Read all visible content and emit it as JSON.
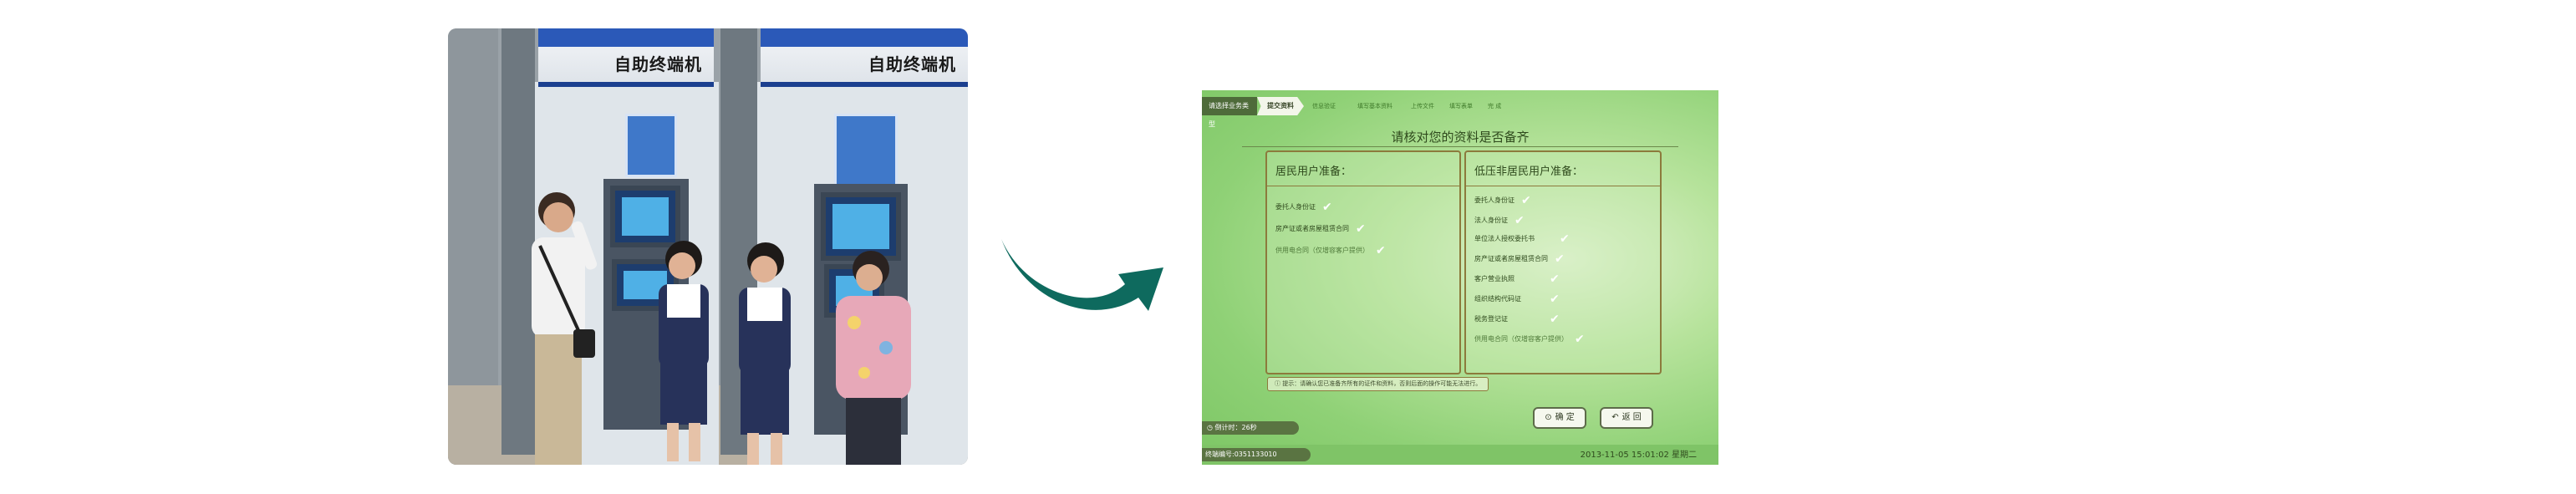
{
  "photo": {
    "kiosk_sign_left": "自助终端机",
    "kiosk_sign_right": "自助终端机"
  },
  "ui": {
    "steps": {
      "active": "请选择业务类型",
      "current": "提交资料",
      "s3": "信息验证",
      "s4": "填写基本资料",
      "s5": "上传文件",
      "s6": "填写表单",
      "s7": "完 成"
    },
    "title": "请核对您的资料是否备齐",
    "resident": {
      "heading": "居民用户准备：",
      "items": [
        {
          "label": "委托人身份证",
          "checked": true
        },
        {
          "label": "房产证或者房屋租赁合同",
          "checked": true
        },
        {
          "label": "供用电合同（仅增容客户提供）",
          "checked": true
        }
      ]
    },
    "non_resident": {
      "heading": "低压非居民用户准备：",
      "items": [
        {
          "label": "委托人身份证",
          "checked": true
        },
        {
          "label": "法人身份证",
          "checked": true
        },
        {
          "label": "单位法人授权委托书",
          "checked": true
        },
        {
          "label": "房产证或者房屋租赁合同",
          "checked": true
        },
        {
          "label": "客户营业执照",
          "checked": true
        },
        {
          "label": "组织结构代码证",
          "checked": true
        },
        {
          "label": "税务登记证",
          "checked": true
        },
        {
          "label": "供用电合同（仅增容客户提供）",
          "checked": true
        }
      ]
    },
    "notice_icon": "info-circle-icon",
    "notice": "提示：请确认您已准备齐所有的证件和资料，否则后面的操作可能无法进行。",
    "confirm_label": "确 定",
    "back_label": "返 回",
    "countdown": "倒计时：26秒",
    "terminal_id": "终端编号:0351133010",
    "datetime": "2013-11-05 15:01:02 星期二",
    "colors": {
      "accent_dark": "#4e6b3a",
      "box_border": "#8c7a3c",
      "bg_green": "#8fd176"
    }
  },
  "arrow": {
    "color": "#0e6a5e"
  }
}
